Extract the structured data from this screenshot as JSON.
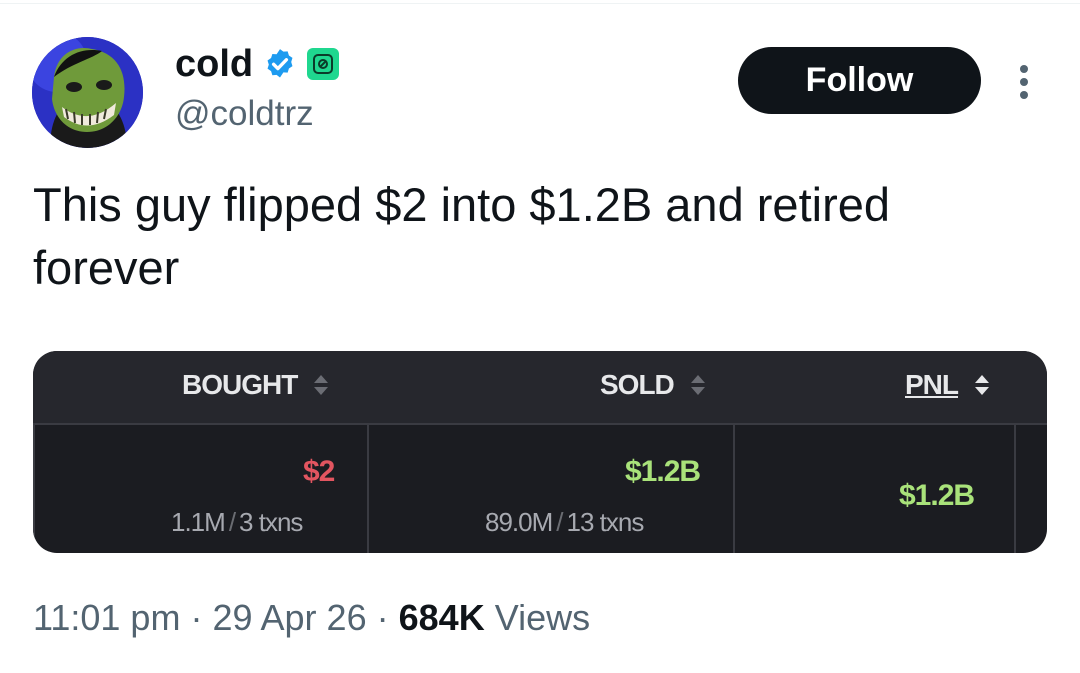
{
  "user": {
    "display_name": "cold",
    "handle": "@coldtrz",
    "verified_icon": "verified-badge-icon",
    "affiliate_icon": "affiliate-badge-icon",
    "colors": {
      "verified": "#1d9bf0",
      "affiliate": "#1fd78f"
    }
  },
  "actions": {
    "follow_label": "Follow"
  },
  "tweet": {
    "text": "This guy flipped $2 into $1.2B and retired forever"
  },
  "media": {
    "headers": [
      "BOUGHT",
      "SOLD",
      "PNL"
    ],
    "bought": {
      "value": "$2",
      "amount": "1.1M",
      "txns": "3 txns"
    },
    "sold": {
      "value": "$1.2B",
      "amount": "89.0M",
      "txns": "13 txns"
    },
    "pnl": {
      "value": "$1.2B"
    },
    "colors": {
      "negative": "#e25560",
      "positive": "#a9e27a"
    }
  },
  "meta": {
    "time": "11:01 pm",
    "separator": "·",
    "date": "29 Apr 26",
    "views_count": "684K",
    "views_label": "Views"
  }
}
